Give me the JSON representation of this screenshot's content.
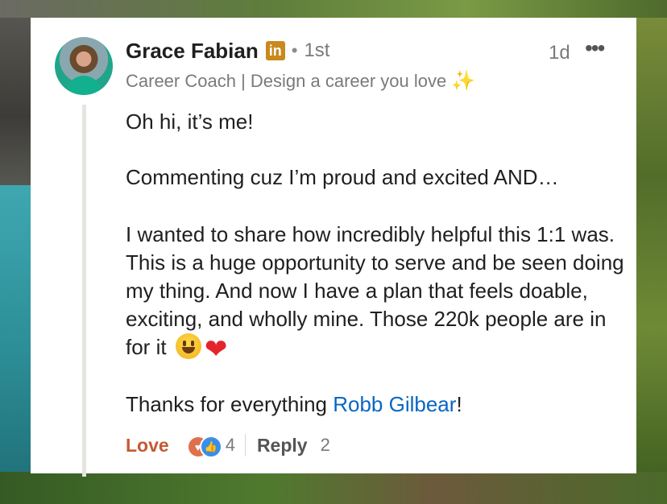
{
  "comment": {
    "author": "Grace Fabian",
    "badge": "in",
    "connection_separator": "•",
    "connection_degree": "1st",
    "headline": "Career Coach | Design a career you love",
    "headline_emoji": "✨",
    "time": "1d",
    "more_label": "•••",
    "body": {
      "line1": "Oh hi, it’s me!",
      "line2": "Commenting cuz I’m proud and excited AND…",
      "paragraph3": "I wanted to share how incredibly helpful this 1:1 was. This is a huge opportunity to serve and be seen doing my thing. And now I have a plan that feels doable, exciting, and wholly mine. Those 220k people are in for it",
      "heart_emoji": "❤",
      "thanks_prefix": "Thanks for everything ",
      "mention": "Robb Gilbear",
      "thanks_suffix": "!"
    },
    "actions": {
      "reaction_label": "Love",
      "reaction_count": "4",
      "reply_label": "Reply",
      "reply_count": "2"
    },
    "icons": {
      "reaction_heart": "heart-icon",
      "reaction_like": "thumbs-up-icon"
    },
    "colors": {
      "linkedin_badge": "#c9891e",
      "love_text": "#c25a34",
      "mention": "#0a66c2",
      "like_blue": "#378fe9",
      "heart_red": "#e3262d"
    }
  }
}
